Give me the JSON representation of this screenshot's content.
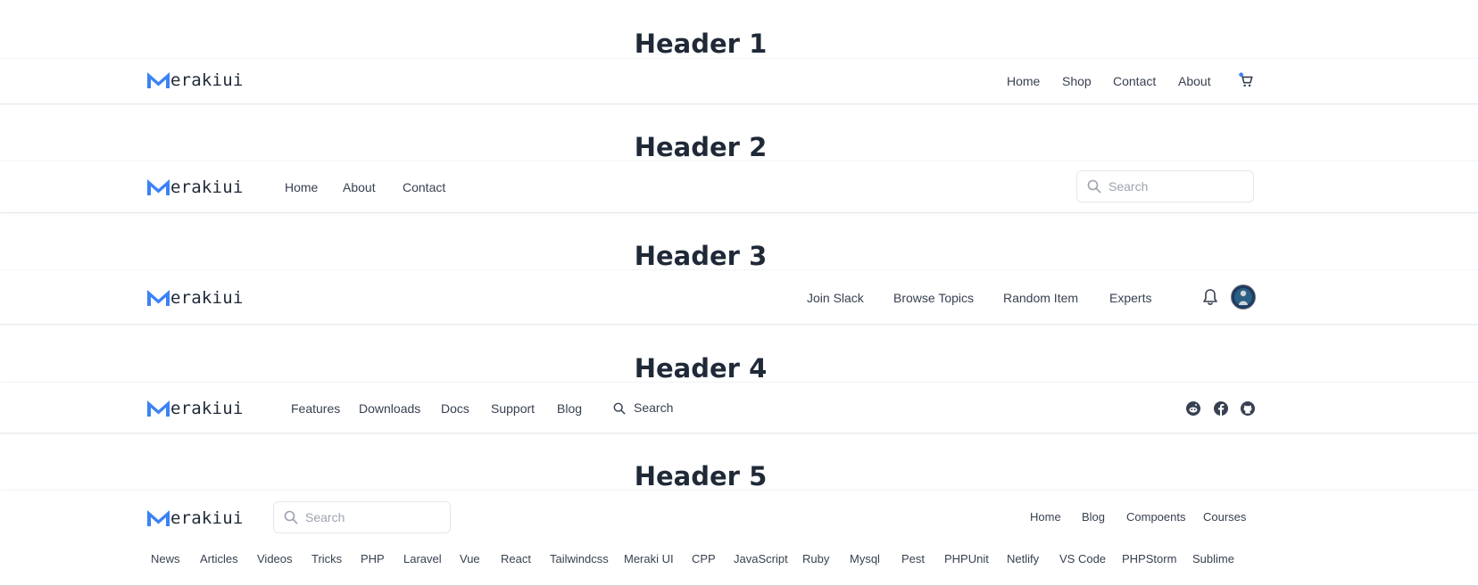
{
  "brand": {
    "logo_text": "erakiui",
    "accent": "#3b82f6"
  },
  "header1": {
    "title": "Header 1",
    "nav": [
      "Home",
      "Shop",
      "Contact",
      "About"
    ],
    "cart_icon": "cart-icon"
  },
  "header2": {
    "title": "Header 2",
    "nav": [
      "Home",
      "About",
      "Contact"
    ],
    "search_placeholder": "Search"
  },
  "header3": {
    "title": "Header 3",
    "nav": [
      "Join Slack",
      "Browse Topics",
      "Random Item",
      "Experts"
    ],
    "icons": [
      "bell-icon",
      "avatar"
    ]
  },
  "header4": {
    "title": "Header 4",
    "nav": [
      "Features",
      "Downloads",
      "Docs",
      "Support",
      "Blog"
    ],
    "search_label": "Search",
    "social": [
      "reddit-icon",
      "facebook-icon",
      "github-icon"
    ]
  },
  "header5": {
    "title": "Header 5",
    "search_placeholder": "Search",
    "nav": [
      "Home",
      "Blog",
      "Compoents",
      "Courses"
    ],
    "categories": [
      "News",
      "Articles",
      "Videos",
      "Tricks",
      "PHP",
      "Laravel",
      "Vue",
      "React",
      "Tailwindcss",
      "Meraki UI",
      "CPP",
      "JavaScript",
      "Ruby",
      "Mysql",
      "Pest",
      "PHPUnit",
      "Netlify",
      "VS Code",
      "PHPStorm",
      "Sublime"
    ]
  }
}
